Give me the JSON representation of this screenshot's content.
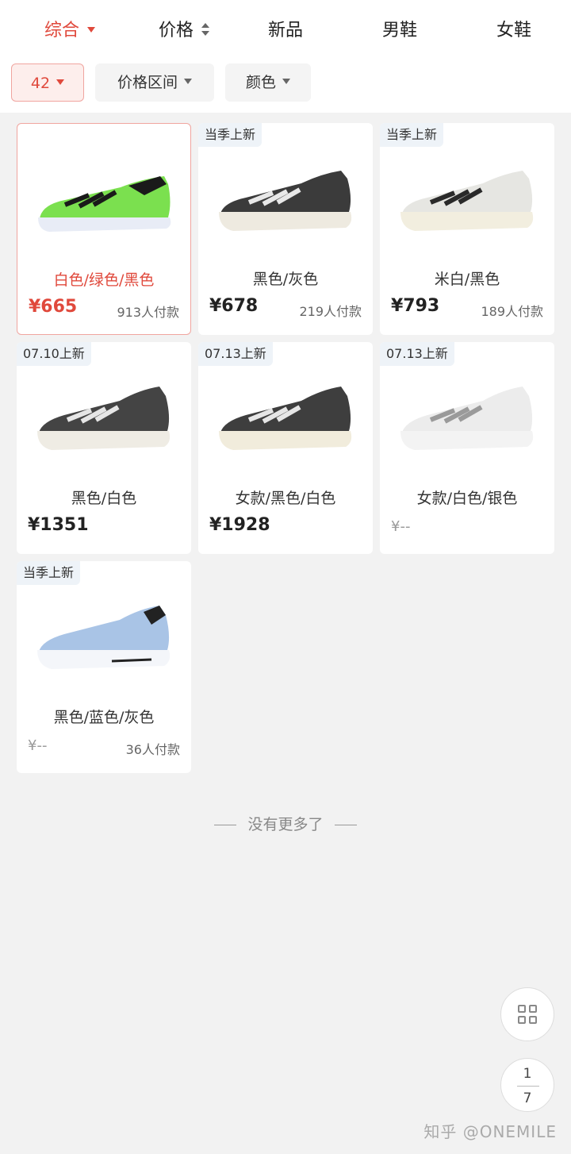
{
  "sort_tabs": [
    {
      "label": "综合"
    },
    {
      "label": "价格"
    },
    {
      "label": "新品"
    },
    {
      "label": "男鞋"
    },
    {
      "label": "女鞋"
    }
  ],
  "filters": [
    {
      "label": "42"
    },
    {
      "label": "价格区间"
    },
    {
      "label": "颜色"
    }
  ],
  "products": [
    {
      "badge": "",
      "name": "白色/绿色/黑色",
      "price": "¥665",
      "paid": "913人付款"
    },
    {
      "badge": "当季上新",
      "name": "黑色/灰色",
      "price": "¥678",
      "paid": "219人付款"
    },
    {
      "badge": "当季上新",
      "name": "米白/黑色",
      "price": "¥793",
      "paid": "189人付款"
    },
    {
      "badge": "07.10上新",
      "name": "黑色/白色",
      "price": "¥1351",
      "paid": ""
    },
    {
      "badge": "07.13上新",
      "name": "女款/黑色/白色",
      "price": "¥1928",
      "paid": ""
    },
    {
      "badge": "07.13上新",
      "name": "女款/白色/银色",
      "price": "¥--",
      "paid": ""
    },
    {
      "badge": "当季上新",
      "name": "黑色/蓝色/灰色",
      "price": "¥--",
      "paid": "36人付款"
    }
  ],
  "no_more": "没有更多了",
  "pager": {
    "current": "1",
    "total": "7"
  },
  "watermark": "知乎 @ONEMILE",
  "colors": {
    "accent": "#e0493c",
    "background": "#f2f2f2"
  }
}
